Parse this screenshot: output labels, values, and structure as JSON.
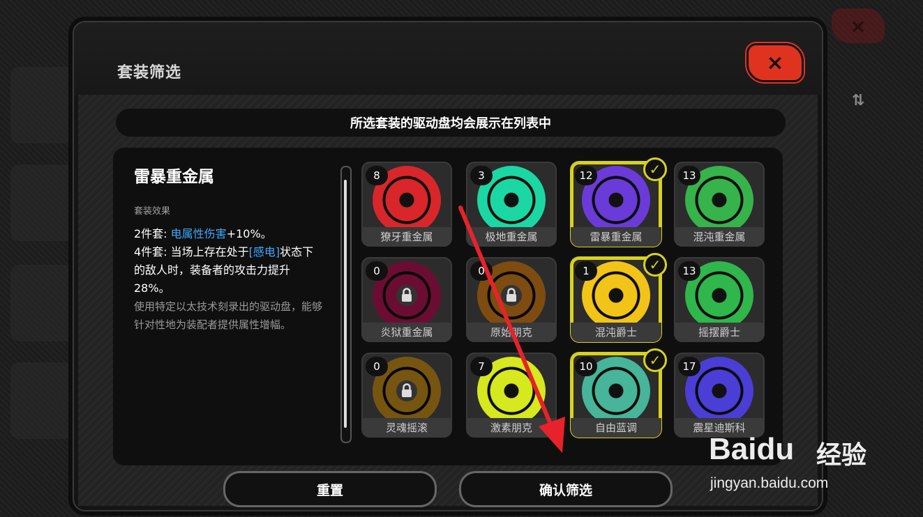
{
  "modal": {
    "title": "套装筛选",
    "close_icon": "×",
    "notice": "所选套装的驱动盘均会展示在列表中"
  },
  "detail": {
    "set_name": "雷暴重金属",
    "effect_label": "套装效果",
    "two_piece_prefix": "2件套: ",
    "two_piece_highlight": "电属性伤害",
    "two_piece_suffix": "+10%。",
    "four_piece_prefix": "4件套: 当场上存在处于",
    "four_piece_highlight": "[感电]",
    "four_piece_suffix": "状态下的敌人时，装备者的攻击力提升28%。",
    "lore": "使用特定以太技术刻录出的驱动盘，能够针对性地为装配者提供属性增幅。"
  },
  "sets": [
    {
      "name": "獠牙重金属",
      "count": "8",
      "color": "#d8262a",
      "selected": false,
      "locked": false
    },
    {
      "name": "极地重金属",
      "count": "3",
      "color": "#1bd7a4",
      "selected": false,
      "locked": false
    },
    {
      "name": "雷暴重金属",
      "count": "12",
      "color": "#6a3bd8",
      "selected": true,
      "locked": false
    },
    {
      "name": "混沌重金属",
      "count": "13",
      "color": "#36b34a",
      "selected": false,
      "locked": false
    },
    {
      "name": "炎狱重金属",
      "count": "0",
      "color": "#c2185b",
      "selected": false,
      "locked": true
    },
    {
      "name": "原始朋克",
      "count": "0",
      "color": "#e58a1e",
      "selected": false,
      "locked": true
    },
    {
      "name": "混沌爵士",
      "count": "1",
      "color": "#f2c417",
      "selected": true,
      "locked": false
    },
    {
      "name": "摇摆爵士",
      "count": "13",
      "color": "#2fb74b",
      "selected": false,
      "locked": false
    },
    {
      "name": "灵魂摇滚",
      "count": "0",
      "color": "#d79a1f",
      "selected": false,
      "locked": true
    },
    {
      "name": "激素朋克",
      "count": "7",
      "color": "#d6e81e",
      "selected": false,
      "locked": false
    },
    {
      "name": "自由蓝调",
      "count": "10",
      "color": "#46b59a",
      "selected": true,
      "locked": false
    },
    {
      "name": "震星迪斯科",
      "count": "17",
      "color": "#4a3ed6",
      "selected": false,
      "locked": false
    }
  ],
  "buttons": {
    "reset": "重置",
    "confirm": "确认筛选"
  },
  "background": {
    "sort_icon": "⇅"
  },
  "watermark": {
    "logo": "Baidu",
    "cn": "经验",
    "url": "jingyan.baidu.com"
  },
  "colors": {
    "selected_border": "#d8d21c",
    "close_button": "#e0331f",
    "highlight": "#3fa8ff",
    "annotation_arrow": "#e8222a"
  },
  "icons": {
    "close": "close-icon",
    "check": "check-icon",
    "lock": "lock-icon",
    "sort": "sort-icon"
  }
}
